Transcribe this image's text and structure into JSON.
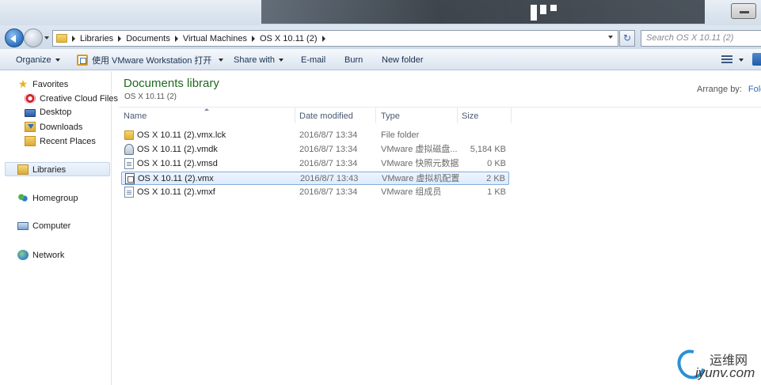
{
  "address_bar": {
    "breadcrumbs": [
      "Libraries",
      "Documents",
      "Virtual Machines",
      "OS X 10.11 (2)"
    ],
    "search_placeholder": "Search OS X 10.11 (2)"
  },
  "toolbar": {
    "organize": "Organize",
    "open_with_vmware": "使用 VMware Workstation 打开",
    "share_with": "Share with",
    "email": "E-mail",
    "burn": "Burn",
    "new_folder": "New folder"
  },
  "nav": {
    "favorites": "Favorites",
    "creative_cloud": "Creative Cloud Files",
    "desktop": "Desktop",
    "downloads": "Downloads",
    "recent_places": "Recent Places",
    "libraries": "Libraries",
    "homegroup": "Homegroup",
    "computer": "Computer",
    "network": "Network"
  },
  "library": {
    "title": "Documents library",
    "subtitle": "OS X 10.11 (2)",
    "arrange_by_label": "Arrange by:",
    "arrange_by_value": "Fold"
  },
  "columns": {
    "name": "Name",
    "date": "Date modified",
    "type": "Type",
    "size": "Size"
  },
  "files": [
    {
      "name": "OS X 10.11 (2).vmx.lck",
      "date": "2016/8/7 13:34",
      "type": "File folder",
      "size": "",
      "icon": "folder-icon"
    },
    {
      "name": "OS X 10.11 (2).vmdk",
      "date": "2016/8/7 13:34",
      "type": "VMware 虚拟磁盘...",
      "size": "5,184 KB",
      "icon": "disk-icon"
    },
    {
      "name": "OS X 10.11 (2).vmsd",
      "date": "2016/8/7 13:34",
      "type": "VMware 快照元数据",
      "size": "0 KB",
      "icon": "document-icon"
    },
    {
      "name": "OS X 10.11 (2).vmx",
      "date": "2016/8/7 13:43",
      "type": "VMware 虚拟机配置",
      "size": "2 KB",
      "icon": "vmx-icon"
    },
    {
      "name": "OS X 10.11 (2).vmxf",
      "date": "2016/8/7 13:34",
      "type": "VMware 组成员",
      "size": "1 KB",
      "icon": "document-icon"
    }
  ],
  "watermark": {
    "cn": "运维网",
    "en": "iyunv.com"
  }
}
